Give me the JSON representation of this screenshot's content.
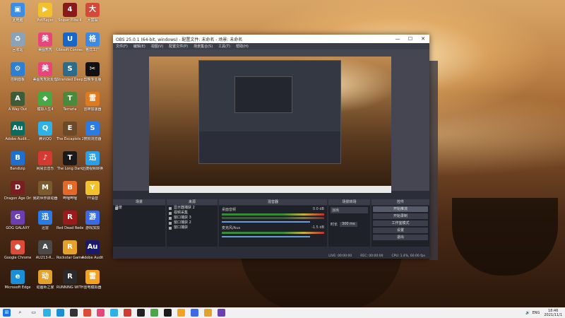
{
  "desktop": {
    "icons": [
      {
        "label": "此电脑",
        "color": "#3a8ee6",
        "glyph": "▣"
      },
      {
        "label": "回收站",
        "color": "#8aa3b8",
        "glyph": "♻"
      },
      {
        "label": "控制面板",
        "color": "#2d7fd1",
        "glyph": "⚙"
      },
      {
        "label": "A Way Out",
        "color": "#3e5c3a",
        "glyph": "A"
      },
      {
        "label": "Adobe Audit...",
        "color": "#0b6b5f",
        "glyph": "Au"
      },
      {
        "label": "Bandizip",
        "color": "#1f6fd1",
        "glyph": "B"
      },
      {
        "label": "Dragon Age Origins",
        "color": "#7a1f1f",
        "glyph": "D"
      },
      {
        "label": "GOG GALAXY",
        "color": "#6a3fb0",
        "glyph": "G"
      },
      {
        "label": "Google Chrome",
        "color": "#dd4b39",
        "glyph": "●"
      },
      {
        "label": "Microsoft Edge",
        "color": "#1a8fd6",
        "glyph": "e"
      },
      {
        "label": "PotPlayer",
        "color": "#f2c12e",
        "glyph": "▶"
      },
      {
        "label": "美图秀秀",
        "color": "#e8457a",
        "glyph": "美"
      },
      {
        "label": "美图秀秀批处理",
        "color": "#e8457a",
        "glyph": "美"
      },
      {
        "label": "模拟人生4",
        "color": "#47a845",
        "glyph": "◆"
      },
      {
        "label": "腾讯QQ",
        "color": "#2bb2e8",
        "glyph": "Q"
      },
      {
        "label": "网易云音乐",
        "color": "#d33a31",
        "glyph": "♪"
      },
      {
        "label": "我的世界启动器",
        "color": "#7a5a2f",
        "glyph": "M"
      },
      {
        "label": "迅雷",
        "color": "#2a7be4",
        "glyph": "迅"
      },
      {
        "label": "AU213-R...",
        "color": "#4a4a4a",
        "glyph": "A"
      },
      {
        "label": "动画师之家",
        "color": "#e3a12b",
        "glyph": "动"
      },
      {
        "label": "Sniper Elite 4",
        "color": "#8a1a1a",
        "glyph": "4"
      },
      {
        "label": "Ubisoft Connect",
        "color": "#1766c8",
        "glyph": "U"
      },
      {
        "label": "Stranded Deep",
        "color": "#2d6b8a",
        "glyph": "S"
      },
      {
        "label": "Terraria",
        "color": "#4a8a3a",
        "glyph": "T"
      },
      {
        "label": "The Escapists 2",
        "color": "#6b4a2a",
        "glyph": "E"
      },
      {
        "label": "The Long Dark",
        "color": "#1a1a1a",
        "glyph": "T"
      },
      {
        "label": "哔哩哔哩",
        "color": "#e3692b",
        "glyph": "B"
      },
      {
        "label": "Red Dead Redemption",
        "color": "#9a1b1b",
        "glyph": "R"
      },
      {
        "label": "Rockstar Games",
        "color": "#e3a12b",
        "glyph": "R"
      },
      {
        "label": "RUNNING WITH",
        "color": "#2b2b2b",
        "glyph": "R"
      },
      {
        "label": "大富翁",
        "color": "#d44a3a",
        "glyph": "大"
      },
      {
        "label": "格式工厂",
        "color": "#3a8ae6",
        "glyph": "格"
      },
      {
        "label": "剪映专业版",
        "color": "#111111",
        "glyph": "✂"
      },
      {
        "label": "雷神加速器",
        "color": "#e07a1f",
        "glyph": "雷"
      },
      {
        "label": "搜狗浏览器",
        "color": "#2a7be4",
        "glyph": "S"
      },
      {
        "label": "迅捷视频转换",
        "color": "#2a9ee6",
        "glyph": "迅"
      },
      {
        "label": "YY语音",
        "color": "#f2c12e",
        "glyph": "Y"
      },
      {
        "label": "游戏加加",
        "color": "#3a6ae6",
        "glyph": "游"
      },
      {
        "label": "Adobe Audit",
        "color": "#1a1a6a",
        "glyph": "Au"
      },
      {
        "label": "雷电模拟器",
        "color": "#f2a21f",
        "glyph": "雷"
      }
    ]
  },
  "obs": {
    "title": "OBS 25.0.1 (64-bit, windows) - 配置文件: 未命名 - 场景: 未命名",
    "menu": [
      "文件(F)",
      "编辑(E)",
      "视图(V)",
      "配置文件(P)",
      "场景集合(S)",
      "工具(T)",
      "帮助(H)"
    ],
    "docks": {
      "scenes": {
        "header": "场景",
        "items": [
          "场景"
        ]
      },
      "sources": {
        "header": "来源",
        "items": [
          "显示器捕获 2",
          "视频采集",
          "窗口捕获 3",
          "窗口捕获 2",
          "窗口捕获"
        ]
      },
      "mixer": {
        "header": "混音器",
        "ch1_label": "桌面音频",
        "ch1_db": "0.0 dB",
        "ch2_label": "麦克风/Aux",
        "ch2_db": "-1.5 dB"
      },
      "transitions": {
        "header": "场景转场",
        "type": "淡出",
        "duration_label": "时长",
        "duration_value": "300 ms"
      },
      "controls": {
        "header": "控件",
        "buttons": [
          "开始录制",
          "工作室模式",
          "设置",
          "退出"
        ],
        "top_button": "开始推流"
      }
    },
    "status": {
      "live": "LIVE: 00:00:00",
      "rec": "REC: 00:00:00",
      "cpu": "CPU: 1.4%, 60.00 fps"
    }
  },
  "taskbar": {
    "tray_lang": "ENG",
    "time": "18:46",
    "date": "2021/11/1"
  }
}
